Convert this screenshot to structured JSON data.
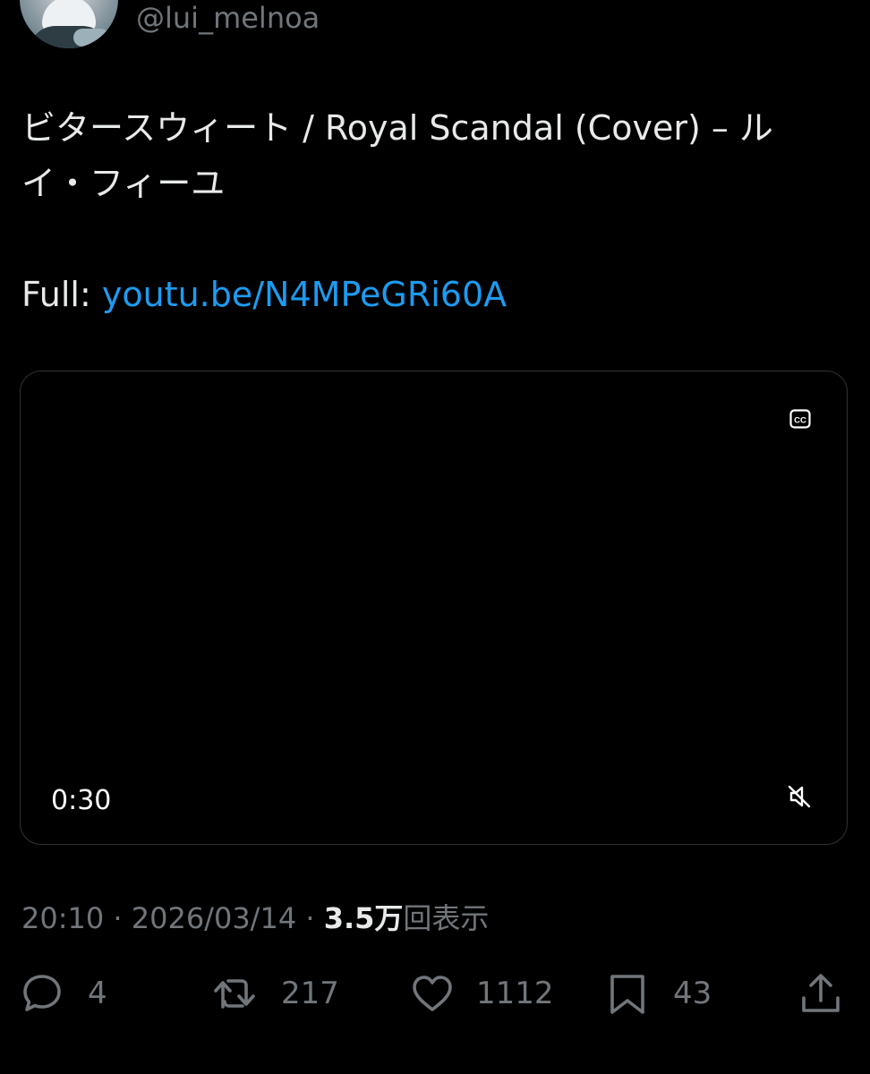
{
  "author": {
    "handle": "@lui_melnoa"
  },
  "tweet": {
    "text": "ビタースウィート / Royal Scandal (Cover) – ル\nイ・フィーユ",
    "full_label": "Full: ",
    "link_text": "youtu.be/N4MPeGRi60A"
  },
  "video": {
    "duration": "0:30"
  },
  "meta": {
    "time": "20:10",
    "separator": "·",
    "date": "2026/03/14",
    "views_number": "3.5万",
    "views_label": "回表示"
  },
  "actions": {
    "replies": "4",
    "retweets": "217",
    "likes": "1112",
    "bookmarks": "43"
  },
  "colors": {
    "background": "#000000",
    "text": "#e7e9ea",
    "secondary": "#71767b",
    "link": "#1d9bf0",
    "border": "#2f3336"
  },
  "icons": [
    "closed-captions-icon",
    "muted-speaker-icon",
    "reply-icon",
    "retweet-icon",
    "heart-icon",
    "bookmark-icon",
    "share-icon"
  ]
}
